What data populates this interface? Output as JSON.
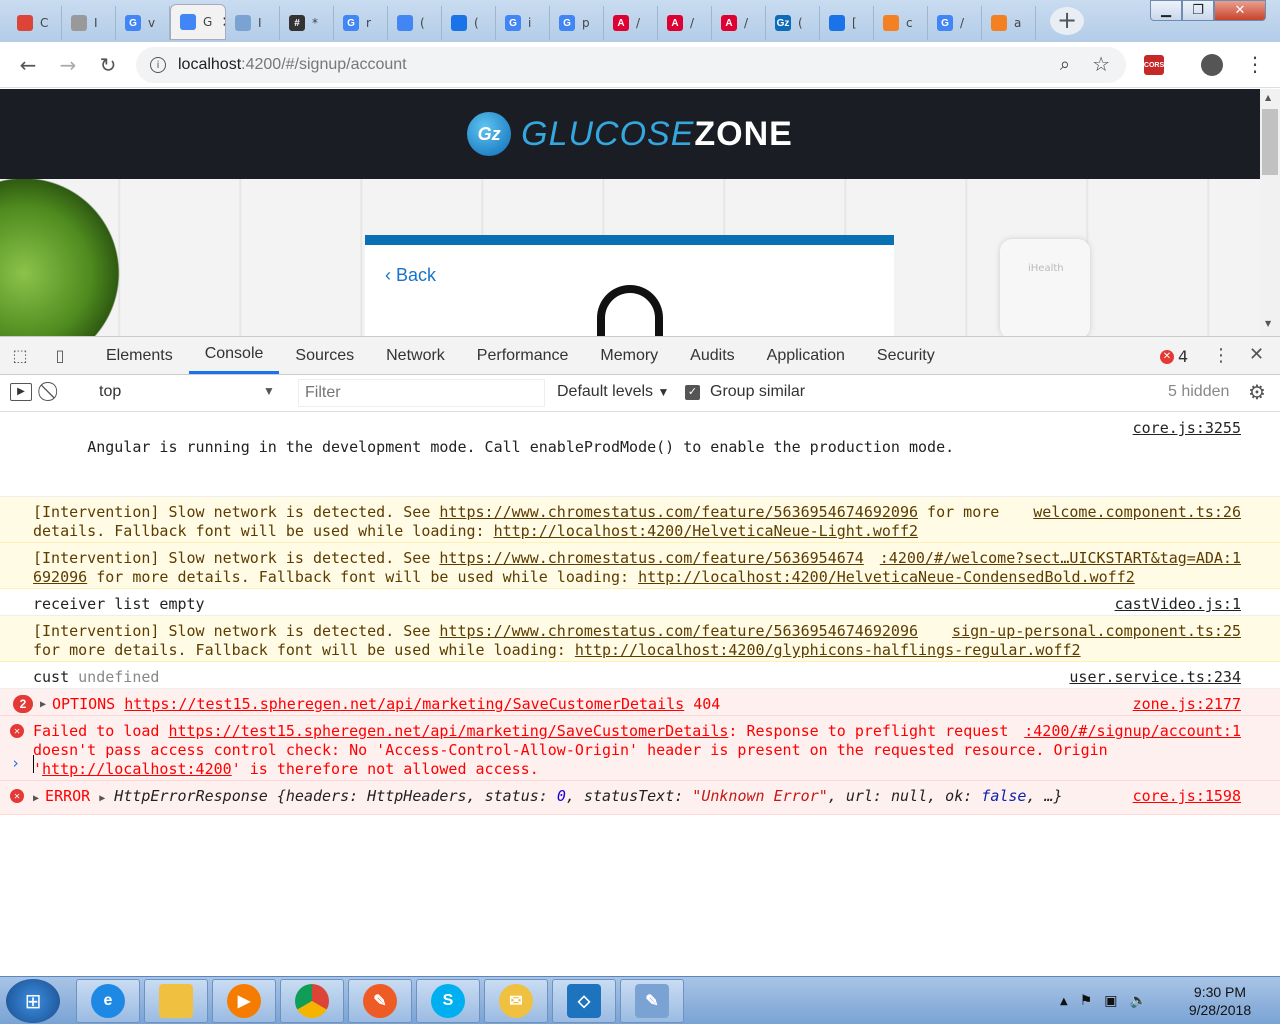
{
  "browser": {
    "tabs": [
      {
        "icon": "chrome-sync-icon",
        "color": "#db4437",
        "letter": "",
        "label": "C"
      },
      {
        "icon": "document-icon",
        "color": "#999",
        "letter": "",
        "label": "I"
      },
      {
        "icon": "google-icon",
        "color": "#4285f4",
        "letter": "G",
        "label": "v"
      },
      {
        "icon": "google-icon",
        "color": "#4285f4",
        "letter": "",
        "label": "G"
      },
      {
        "icon": "document-icon",
        "color": "#7aa3d4",
        "letter": "",
        "label": "I"
      },
      {
        "icon": "hashtag-icon",
        "color": "#333",
        "letter": "#",
        "label": "*"
      },
      {
        "icon": "google-icon",
        "color": "#4285f4",
        "letter": "G",
        "label": "r"
      },
      {
        "icon": "docs-icon",
        "color": "#4285f4",
        "letter": "",
        "label": "("
      },
      {
        "icon": "shield-icon",
        "color": "#1a73e8",
        "letter": "",
        "label": "("
      },
      {
        "icon": "google-icon",
        "color": "#4285f4",
        "letter": "G",
        "label": "i"
      },
      {
        "icon": "google-icon",
        "color": "#4285f4",
        "letter": "G",
        "label": "p"
      },
      {
        "icon": "angular-icon",
        "color": "#dd0031",
        "letter": "A",
        "label": "/"
      },
      {
        "icon": "angular-icon",
        "color": "#dd0031",
        "letter": "A",
        "label": "/"
      },
      {
        "icon": "angular-icon",
        "color": "#dd0031",
        "letter": "A",
        "label": "/"
      },
      {
        "icon": "glucosezone-icon",
        "color": "#0d6bb8",
        "letter": "Gz",
        "label": "("
      },
      {
        "icon": "diamond-icon",
        "color": "#1a73e8",
        "letter": "",
        "label": "["
      },
      {
        "icon": "stackoverflow-icon",
        "color": "#f48024",
        "letter": "",
        "label": "c"
      },
      {
        "icon": "google-icon",
        "color": "#4285f4",
        "letter": "G",
        "label": "/"
      },
      {
        "icon": "stackoverflow-icon",
        "color": "#f48024",
        "letter": "",
        "label": "a"
      }
    ],
    "active_tab": 3,
    "url_host": "localhost",
    "url_rest": ":4200/#/signup/account",
    "cors_label": "CORS"
  },
  "page": {
    "brand_logo": "Gz",
    "brand_part1": "GLUCOSE",
    "brand_part2": "ZONE",
    "back_label": "Back",
    "device_label": "iHealth"
  },
  "devtools": {
    "tabs": [
      "Elements",
      "Console",
      "Sources",
      "Network",
      "Performance",
      "Memory",
      "Audits",
      "Application",
      "Security"
    ],
    "selected_tab": "Console",
    "error_count": "4",
    "context": "top",
    "filter_placeholder": "Filter",
    "levels": "Default levels",
    "group_similar": "Group similar",
    "hidden": "5 hidden"
  },
  "console": {
    "angular_msg": "Angular is running in the development mode. Call enableProdMode() to enable the production mode.",
    "angular_src": "core.js:3255",
    "int1_pre": "[Intervention] Slow network is detected. See ",
    "int1_link": "https://www.chromestatus.com/feature/5636954674692096",
    "int1_mid": " for more\ndetails. Fallback font will be used while loading: ",
    "int1_font": "http://localhost:4200/HelveticaNeue-Light.woff2",
    "int1_src": "welcome.component.ts:26",
    "int2_pre": "[Intervention] Slow network is detected. See ",
    "int2_link_a": "https://www.chromestatus.com/feature/5636954674",
    "int2_link_b": "692096",
    "int2_mid": " for more details. Fallback font will be used while loading: ",
    "int2_font": "http://localhost:4200/HelveticaNeue-CondensedBold.woff2",
    "int2_src": ":4200/#/welcome?sect…UICKSTART&tag=ADA:1",
    "receiver_msg": "receiver list empty",
    "receiver_src": "castVideo.js:1",
    "int3_pre": "[Intervention] Slow network is detected. See ",
    "int3_link": "https://www.chromestatus.com/feature/5636954674692096",
    "int3_mid": "\nfor more details. Fallback font will be used while loading: ",
    "int3_font": "http://localhost:4200/glyphicons-halflings-regular.woff2",
    "int3_src": "sign-up-personal.component.ts:25",
    "cust_label": "cust",
    "cust_value": "undefined",
    "cust_src": "user.service.ts:234",
    "options_count": "2",
    "options_method": "OPTIONS",
    "options_url": "https://test15.spheregen.net/api/marketing/SaveCustomerDetails",
    "options_status": "404",
    "options_src": "zone.js:2177",
    "fail_pre": "Failed to load ",
    "fail_url": "https://test15.spheregen.net/api/marketing/SaveCustomerDetails",
    "fail_mid": ": Response to preflight request\ndoesn't pass access control check: No 'Access-Control-Allow-Origin' header is present on the requested resource. Origin '",
    "fail_origin": "http://localhost:4200",
    "fail_post": "' is therefore not allowed access.",
    "fail_src": ":4200/#/signup/account:1",
    "error_label": "ERROR",
    "error_type": "HttpErrorResponse",
    "error_headers_key": "headers",
    "error_headers_val": "HttpHeaders",
    "error_status_key": "status",
    "error_status_val": "0",
    "error_statustext_key": "statusText",
    "error_statustext_val": "\"Unknown Error\"",
    "error_url_key": "url",
    "error_url_val": "null",
    "error_ok_key": "ok",
    "error_ok_val": "false",
    "error_src": "core.js:1598"
  },
  "taskbar": {
    "apps": [
      {
        "name": "internet-explorer",
        "color": "#1e88e5",
        "glyph": "e"
      },
      {
        "name": "file-explorer",
        "color": "#f0c040",
        "glyph": ""
      },
      {
        "name": "media-player",
        "color": "#f57c00",
        "glyph": "▶"
      },
      {
        "name": "chrome",
        "color": "#db4437",
        "glyph": ""
      },
      {
        "name": "postman",
        "color": "#ef5b25",
        "glyph": "✎"
      },
      {
        "name": "skype",
        "color": "#00aff0",
        "glyph": "S"
      },
      {
        "name": "outlook",
        "color": "#f0c040",
        "glyph": "✉"
      },
      {
        "name": "vscode",
        "color": "#1e73be",
        "glyph": "◇"
      },
      {
        "name": "notepad",
        "color": "#7aa3d4",
        "glyph": "✎"
      }
    ],
    "time": "9:30 PM",
    "date": "9/28/2018"
  }
}
